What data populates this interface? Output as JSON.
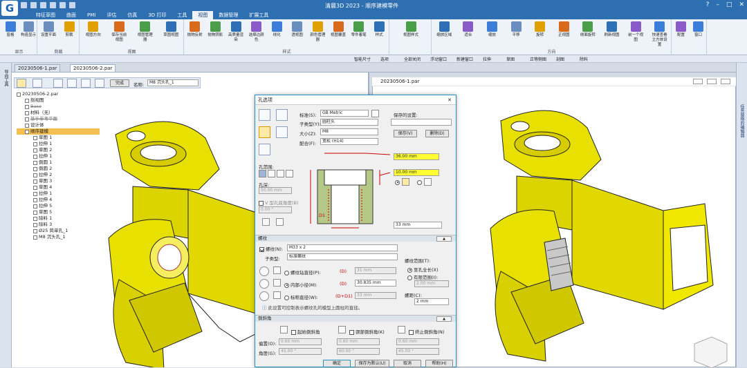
{
  "app": {
    "window_title": "清晨3D 2023 - 顺序建模零件",
    "logo_glyph": "G",
    "win_buttons": [
      "?",
      "–",
      "□",
      "✕"
    ]
  },
  "menu_tabs": [
    "特征草图",
    "曲面",
    "PMI",
    "评估",
    "仿真",
    "3D 打印",
    "工具",
    "视图",
    "数据管理",
    "扩展工具"
  ],
  "active_tab": "视图",
  "ribbon": {
    "groups": [
      {
        "label": "显示",
        "buttons": [
          "窗格",
          "构造显示"
        ]
      },
      {
        "label": "剪裁",
        "buttons": [
          "设置平面",
          "剪裁"
        ]
      },
      {
        "label": "视图",
        "buttons": [
          "视图方向",
          "保存当前视图",
          "视图管理器",
          "草图视图"
        ]
      },
      {
        "label": "样式",
        "buttons": [
          "抛物反射",
          "抛物阴影",
          "高质量渲染",
          "选择边颜色",
          "线化",
          "透视图",
          "颜色管理器",
          "视图覆盖",
          "零件着笔",
          "样式"
        ]
      },
      {
        "label": "",
        "buttons": [
          "视图样式"
        ]
      },
      {
        "label": "方向",
        "buttons": [
          "缩放区域",
          "适合",
          "缩放",
          "平移",
          "旋转",
          "正视图",
          "绕面旋转",
          "刷新视图",
          "前一个视图",
          "快速查看立方体设置"
        ]
      },
      {
        "label": "",
        "buttons": [
          "配置",
          "窗口"
        ]
      }
    ]
  },
  "cmdbar": {
    "items": [
      "智能尺寸",
      "选项",
      "全部关闭",
      "浮动窗口",
      "新建窗口",
      "拉伸",
      "草图",
      "正等侧图",
      "剖图",
      "除料"
    ]
  },
  "left_strip_label": "导向工具",
  "right_strip_label": "任务窗格的编辑器",
  "doc_tabs": [
    "20230506-1.par",
    "20230506-2.par"
  ],
  "doc2_title": "20230506-1.par",
  "optbar": {
    "finish": "完成",
    "name_label": "名称:",
    "name_value": "M8 沉头孔_1"
  },
  "tree": [
    {
      "label": "20230506-2.par",
      "lvl": 0
    },
    {
      "label": "剖视图",
      "lvl": 1
    },
    {
      "label": "Base",
      "lvl": 1,
      "strike": true
    },
    {
      "label": "材料（无）",
      "lvl": 1
    },
    {
      "label": "基于参考平面",
      "lvl": 1,
      "strike": true
    },
    {
      "label": "设计体",
      "lvl": 1
    },
    {
      "label": "顺序建模",
      "lvl": 1,
      "sel": true
    },
    {
      "label": "草图 1",
      "lvl": 2
    },
    {
      "label": "拉伸 1",
      "lvl": 2
    },
    {
      "label": "草图 2",
      "lvl": 2
    },
    {
      "label": "拉伸 1",
      "lvl": 2
    },
    {
      "label": "倒圆 1",
      "lvl": 2
    },
    {
      "label": "倒圆 2",
      "lvl": 2
    },
    {
      "label": "拉伸 2",
      "lvl": 2
    },
    {
      "label": "草图 3",
      "lvl": 2
    },
    {
      "label": "草图 4",
      "lvl": 2
    },
    {
      "label": "拉伸 1",
      "lvl": 2
    },
    {
      "label": "拉伸 4",
      "lvl": 2
    },
    {
      "label": "拉伸 5",
      "lvl": 2
    },
    {
      "label": "草图 5",
      "lvl": 2
    },
    {
      "label": "除料 1",
      "lvl": 2
    },
    {
      "label": "除料 3",
      "lvl": 2
    },
    {
      "label": "Ø25 简单孔_1",
      "lvl": 2
    },
    {
      "label": "M8 沉头孔_1",
      "lvl": 2
    }
  ],
  "dialog": {
    "title": "孔选项",
    "standard_label": "标准(S):",
    "standard_value": "GB Metric",
    "subtype_label": "子类型(Y):",
    "subtype_value": "圆柱头",
    "size_label": "大小(Z):",
    "size_value": "M8",
    "fit_label": "配合(F):",
    "fit_value": "宽松 (H14)",
    "saved_label": "保存的设置:",
    "saved_value": "",
    "save_btn": "保存(V)",
    "delete_btn": "删除(D)",
    "extent_label": "孔范围:",
    "depth_label": "孔深:",
    "depth_value": "50.00 mm",
    "vbottom_label": "V 型孔底角度(B)",
    "vbottom_value": "0.00 °",
    "dim1": "36.00 mm",
    "dim2": "10.00 mm",
    "dim3": "33 mm",
    "d1_label": "D1",
    "thread_section": "螺纹",
    "thread_cb": "螺纹(N):",
    "thread_value": "M33 x 2",
    "thread_subtype_label": "子类型:",
    "thread_subtype": "标准螺纹",
    "r1": "螺纹钻直径(P):",
    "r1_d": "(D)",
    "r1_v": "31 mm",
    "r2": "内部小径(M):",
    "r2_d": "(D)",
    "r2_v": "30.835 mm",
    "r3": "标称直径(W):",
    "r3_d": "(D+D1)",
    "r3_v": "33 mm",
    "note": "此设置可控制表示螺纹孔的模型上圆柱的直径。",
    "range_label": "螺纹范围(T):",
    "range_opt1": "至孔全长(X)",
    "range_opt2": "有限范围(I):",
    "range_value": "2.00 mm",
    "pitch_label": "螺距(C):",
    "pitch_value": "2 mm",
    "chamfer_section": "倒斜角",
    "c1": "起始倒斜角",
    "c2": "颈部倒斜角(K)",
    "c3": "终止倒斜角(N)",
    "offset_label": "偏置(O):",
    "offset_vals": [
      "0.60 mm",
      "0.60 mm",
      "0.60 mm"
    ],
    "angle_label": "角度(G):",
    "angle_vals": [
      "45.00 °",
      "60.00 °",
      "45.00 °"
    ],
    "ok": "确定",
    "save_default": "保存为默认(U)",
    "cancel": "取消",
    "help": "帮助(H)",
    "collapse": "▲"
  },
  "colors": {
    "part_yellow": "#e8e000",
    "highlight": "#ffff33",
    "title_blue": "#2d6fb0"
  }
}
